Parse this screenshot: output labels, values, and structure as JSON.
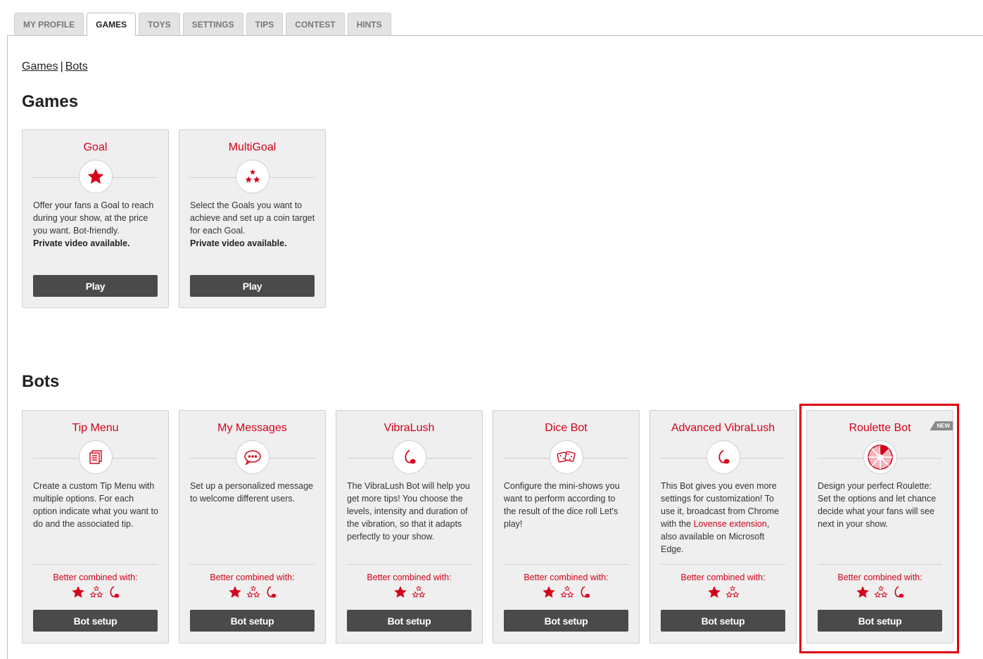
{
  "tabs": [
    {
      "label": "MY PROFILE"
    },
    {
      "label": "GAMES"
    },
    {
      "label": "TOYS"
    },
    {
      "label": "SETTINGS"
    },
    {
      "label": "TIPS"
    },
    {
      "label": "CONTEST"
    },
    {
      "label": "HINTS"
    }
  ],
  "breadcrumb": {
    "games": "Games",
    "separator": "|",
    "bots": "Bots"
  },
  "sections": {
    "games_title": "Games",
    "bots_title": "Bots"
  },
  "games": [
    {
      "title": "Goal",
      "icon": "star-icon",
      "desc": "Offer your fans a Goal to reach during your show, at the price you want. Bot-friendly.",
      "bold": "Private video available.",
      "button": "Play"
    },
    {
      "title": "MultiGoal",
      "icon": "multi-star-icon",
      "desc": "Select the Goals you want to achieve and set up a coin target for each Goal.",
      "bold": "Private video available.",
      "button": "Play"
    }
  ],
  "bots": [
    {
      "title": "Tip Menu",
      "icon": "menu-list-icon",
      "desc": "Create a custom Tip Menu with multiple options. For each option indicate what you want to do and the associated tip.",
      "combined_label": "Better combined with:",
      "button": "Bot setup"
    },
    {
      "title": "My Messages",
      "icon": "chat-bubble-icon",
      "desc": "Set up a personalized message to welcome different users.",
      "combined_label": "Better combined with:",
      "button": "Bot setup"
    },
    {
      "title": "VibraLush",
      "icon": "lush-toy-icon",
      "desc": "The VibraLush Bot will help you get more tips! You choose the levels, intensity and duration of the vibration, so that it adapts perfectly to your show.",
      "combined_label": "Better combined with:",
      "button": "Bot setup"
    },
    {
      "title": "Dice Bot",
      "icon": "dice-icon",
      "desc": "Configure the mini-shows you want to perform according to the result of the dice roll Let's play!",
      "combined_label": "Better combined with:",
      "button": "Bot setup"
    },
    {
      "title": "Advanced VibraLush",
      "icon": "lush-toy-icon",
      "desc_before": "This Bot gives you even more settings for customization! To use it, broadcast from Chrome with the ",
      "desc_link": "Lovense extension",
      "desc_after": ", also available on Microsoft Edge.",
      "combined_label": "Better combined with:",
      "button": "Bot setup"
    },
    {
      "title": "Roulette Bot",
      "icon": "roulette-wheel-icon",
      "badge": "NEW",
      "desc": "Design your perfect Roulette: Set the options and let chance decide what your fans will see next in your show.",
      "combined_label": "Better combined with:",
      "button": "Bot setup"
    }
  ],
  "colors": {
    "accent": "#d50019",
    "button": "#4a4a4a",
    "card_bg": "#efefef",
    "highlight": "#e00012"
  }
}
